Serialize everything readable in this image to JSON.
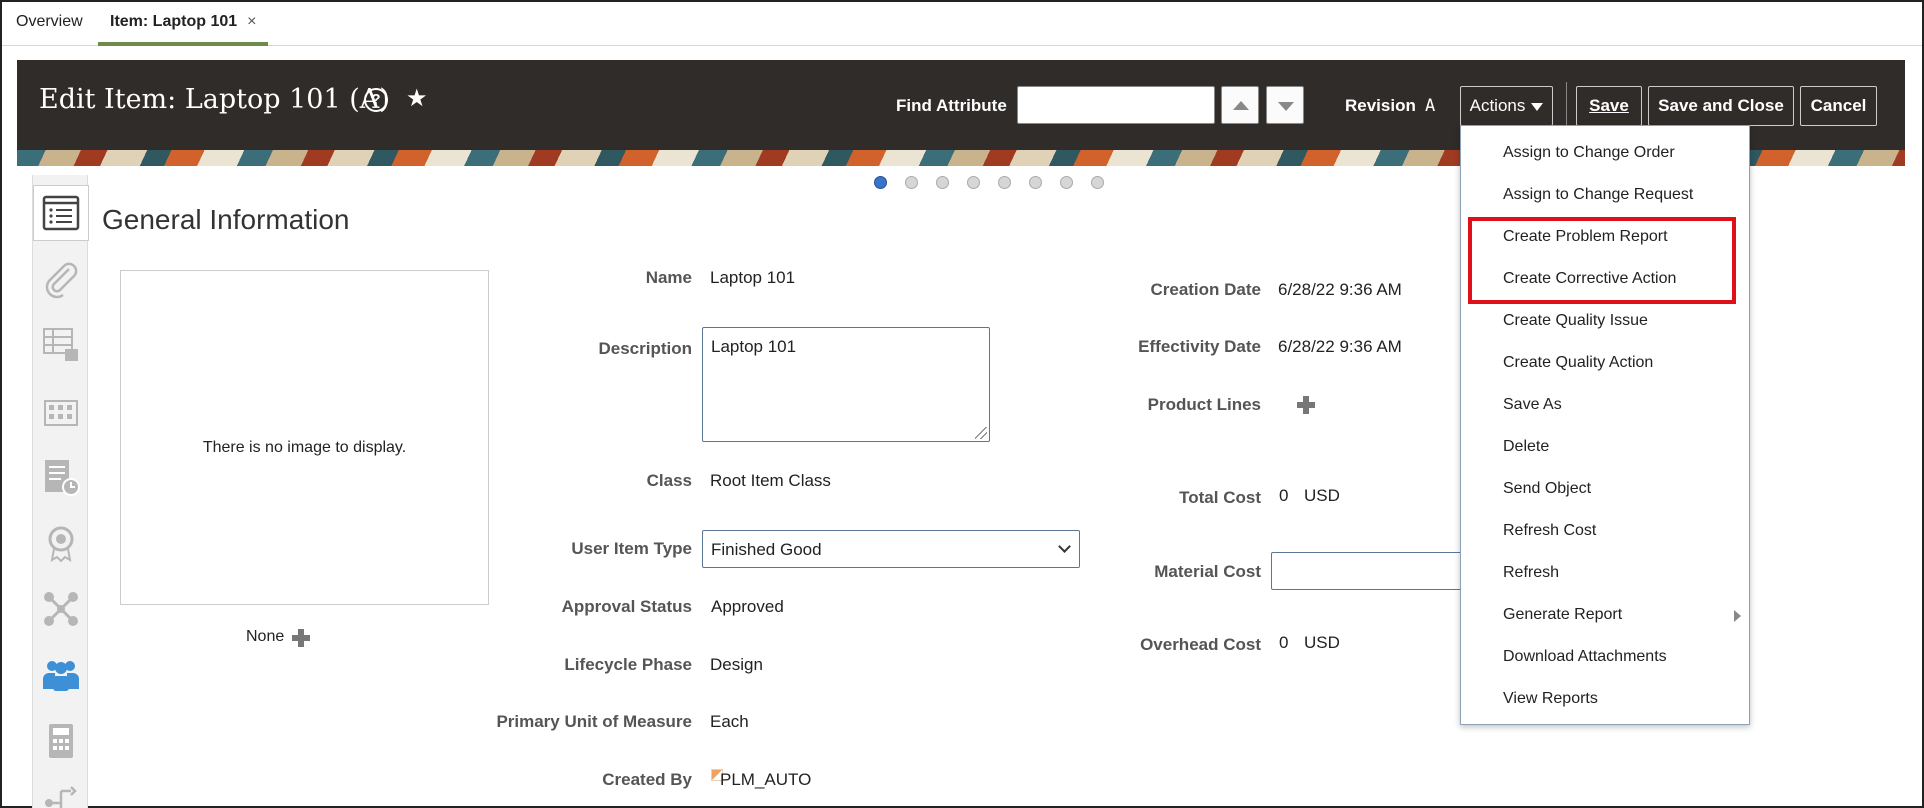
{
  "tabs": {
    "overview": "Overview",
    "active": "Item: Laptop 101",
    "close_glyph": "×"
  },
  "header": {
    "title": "Edit Item: Laptop 101 (A)",
    "help_glyph": "?",
    "star_glyph": "★",
    "find_label": "Find Attribute",
    "find_value": "",
    "revision_label": "Revision",
    "revision_value": "A",
    "actions_label": "Actions",
    "save_label": "Save",
    "save_close_label": "Save and Close",
    "cancel_label": "Cancel"
  },
  "rail": {
    "items": [
      {
        "name": "general-info-icon",
        "active": true
      },
      {
        "name": "attachments-icon",
        "active": false
      },
      {
        "name": "structure-icon",
        "active": false
      },
      {
        "name": "organization-icon",
        "active": false
      },
      {
        "name": "history-icon",
        "active": false
      },
      {
        "name": "quality-icon",
        "active": false
      },
      {
        "name": "relationships-icon",
        "active": false
      },
      {
        "name": "people-icon",
        "active": false
      },
      {
        "name": "calculator-icon",
        "active": false
      },
      {
        "name": "workflow-icon",
        "active": false
      }
    ],
    "accent_color": "#3d8fd6",
    "icon_color": "#b6b6b6"
  },
  "carousel": {
    "count": 8,
    "active_index": 0
  },
  "section": {
    "title": "General Information"
  },
  "image": {
    "message": "There is no image to display.",
    "none_label": "None"
  },
  "form": {
    "name_label": "Name",
    "name_value": "Laptop 101",
    "description_label": "Description",
    "description_value": "Laptop 101",
    "class_label": "Class",
    "class_value": "Root Item Class",
    "user_item_type_label": "User Item Type",
    "user_item_type_value": "Finished Good",
    "approval_status_label": "Approval Status",
    "approval_status_value": "Approved",
    "lifecycle_label": "Lifecycle Phase",
    "lifecycle_value": "Design",
    "uom_label": "Primary Unit of Measure",
    "uom_value": "Each",
    "created_by_label": "Created By",
    "created_by_value": "PLM_AUTO",
    "creation_date_label": "Creation Date",
    "creation_date_value": "6/28/22 9:36 AM",
    "effectivity_date_label": "Effectivity Date",
    "effectivity_date_value": "6/28/22 9:36 AM",
    "product_lines_label": "Product Lines",
    "total_cost_label": "Total Cost",
    "total_cost_value": "0",
    "total_cost_currency": "USD",
    "material_cost_label": "Material Cost",
    "material_cost_value": "",
    "overhead_cost_label": "Overhead Cost",
    "overhead_cost_value": "0",
    "overhead_cost_currency": "USD"
  },
  "actions_menu": {
    "items": [
      "Assign to Change Order",
      "Assign to Change Request",
      "Create Problem Report",
      "Create Corrective Action",
      "Create Quality Issue",
      "Create Quality Action",
      "Save As",
      "Delete",
      "Send Object",
      "Refresh Cost",
      "Refresh",
      "Generate Report",
      "Download Attachments",
      "View Reports"
    ],
    "submenu_items": [
      "Generate Report"
    ],
    "highlighted_items": [
      "Create Problem Report",
      "Create Corrective Action"
    ],
    "highlight_color": "#e0101a"
  },
  "colors": {
    "header_bg": "#302c2a",
    "active_tab_underline": "#6e8b4c",
    "carousel_active": "#3a74c8"
  }
}
